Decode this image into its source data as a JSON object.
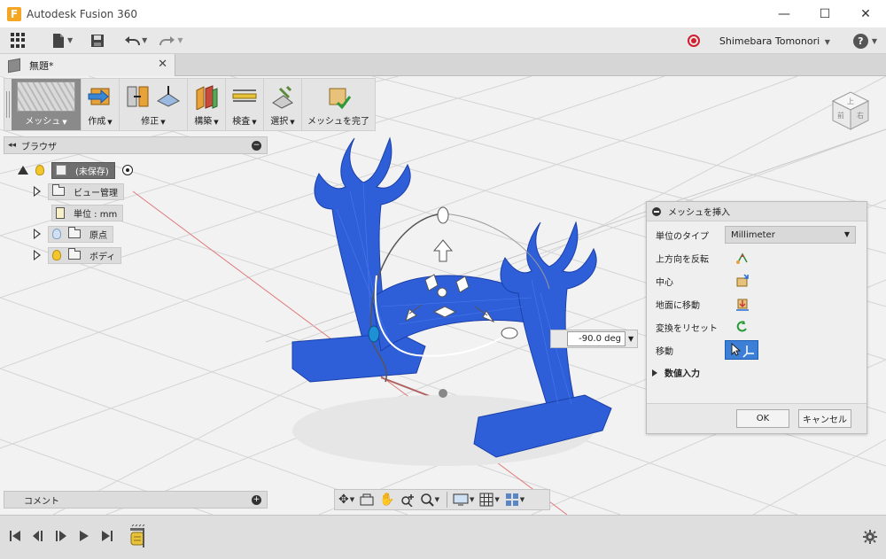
{
  "window": {
    "title": "Autodesk Fusion 360",
    "app_logo_letter": "F",
    "minimize_glyph": "—",
    "maximize_glyph": "☐",
    "close_glyph": "✕"
  },
  "quick_access": {
    "user_name": "Shimebara Tomonori",
    "help_glyph": "?"
  },
  "tab": {
    "title": "無題*",
    "close_glyph": "✕"
  },
  "toolbar": {
    "groups": [
      {
        "label": "メッシュ",
        "icon": "mesh-workspace-icon",
        "active": true
      },
      {
        "label": "作成",
        "icon": "create-icon"
      },
      {
        "label": "修正",
        "icon": "modify-icon"
      },
      {
        "label": "構築",
        "icon": "construct-icon"
      },
      {
        "label": "検査",
        "icon": "inspect-icon"
      },
      {
        "label": "選択",
        "icon": "select-icon"
      },
      {
        "label": "メッシュを完了",
        "icon": "finish-mesh-icon"
      }
    ]
  },
  "browser": {
    "title": "ブラウザ",
    "root_label": "(未保存)",
    "items": [
      {
        "label": "ビュー管理",
        "icon": "folder-icon"
      },
      {
        "label": "単位 : mm",
        "icon": "document-icon"
      },
      {
        "label": "原点",
        "icon": "folder-icon"
      },
      {
        "label": "ボディ",
        "icon": "folder-icon"
      }
    ]
  },
  "comments": {
    "title": "コメント"
  },
  "dialog": {
    "title": "メッシュを挿入",
    "unit_type_label": "単位のタイプ",
    "unit_type_value": "Millimeter",
    "flip_up_label": "上方向を反転",
    "center_label": "中心",
    "move_to_ground_label": "地面に移動",
    "reset_transform_label": "変換をリセット",
    "move_label": "移動",
    "numeric_input_label": "数値入力",
    "ok_label": "OK",
    "cancel_label": "キャンセル"
  },
  "manipulator": {
    "angle_value": "-90.0 deg"
  },
  "viewcube": {
    "top_face": "上",
    "front_face": "前",
    "right_face": "右"
  },
  "colors": {
    "model_blue": "#2f5fd8",
    "accent_blue": "#3d7fd6",
    "record_red": "#d01f2f"
  }
}
